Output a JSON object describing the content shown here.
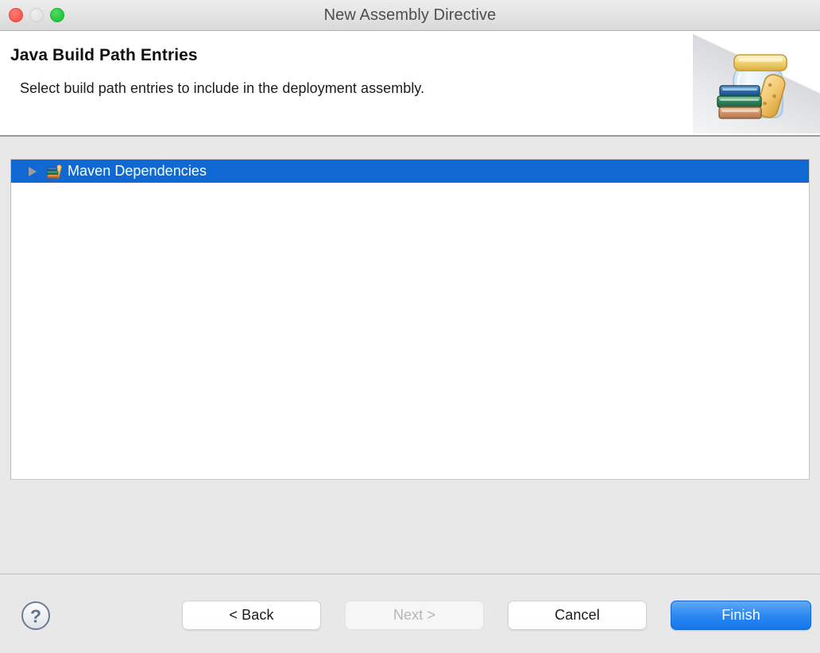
{
  "window": {
    "title": "New Assembly Directive",
    "controls": {
      "close_label": "close-window",
      "minimize_label": "minimize-window",
      "zoom_label": "zoom-window"
    }
  },
  "header": {
    "title": "Java Build Path Entries",
    "description": "Select build path entries to include in the deployment assembly.",
    "banner_icon": "jar-with-books-icon"
  },
  "tree": {
    "items": [
      {
        "label": "Maven Dependencies",
        "icon": "maven-library-icon",
        "expanded": false,
        "selected": true
      }
    ]
  },
  "footer": {
    "help_icon": "question-mark-icon",
    "buttons": {
      "back": "< Back",
      "next": "Next >",
      "cancel": "Cancel",
      "finish": "Finish"
    }
  },
  "colors": {
    "selection_blue": "#1069d2",
    "primary_button_blue": "#2e8af2",
    "header_background": "#ffffff",
    "body_background": "#e8e8e8",
    "traffic_close": "#fb564c",
    "traffic_minimize": "#e2e2e2",
    "traffic_zoom": "#24c53a"
  }
}
